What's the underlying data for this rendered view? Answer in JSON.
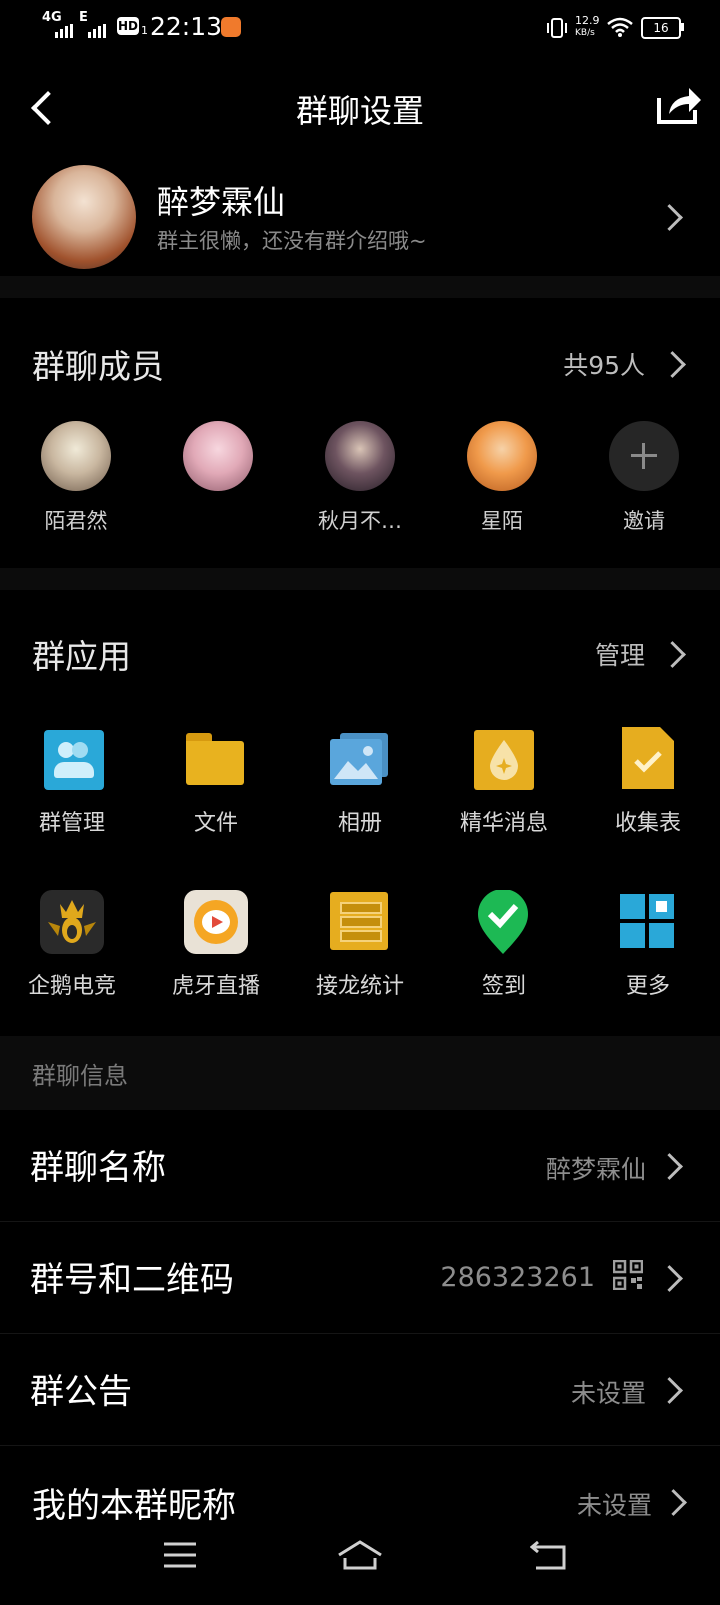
{
  "status_bar": {
    "network1": "4G",
    "network2": "E",
    "hd": "HD",
    "hd_sub": "1",
    "time": "22:13",
    "speed_value": "12.9",
    "speed_unit": "KB/s",
    "battery": "16"
  },
  "header": {
    "title": "群聊设置"
  },
  "group": {
    "name": "醉梦霖仙",
    "description": "群主很懒，还没有群介绍哦~"
  },
  "members": {
    "title": "群聊成员",
    "count": "共95人",
    "list": [
      {
        "name": "陌君然"
      },
      {
        "name": ""
      },
      {
        "name": "秋月不…"
      },
      {
        "name": "星陌"
      },
      {
        "name": "邀请"
      }
    ]
  },
  "apps": {
    "title": "群应用",
    "manage": "管理",
    "items": [
      {
        "label": "群管理",
        "icon": "group-manage-icon"
      },
      {
        "label": "文件",
        "icon": "folder-icon"
      },
      {
        "label": "相册",
        "icon": "album-icon"
      },
      {
        "label": "精华消息",
        "icon": "essence-icon"
      },
      {
        "label": "收集表",
        "icon": "collect-form-icon"
      },
      {
        "label": "企鹅电竞",
        "icon": "penguin-esports-icon"
      },
      {
        "label": "虎牙直播",
        "icon": "huya-live-icon"
      },
      {
        "label": "接龙统计",
        "icon": "solitaire-icon"
      },
      {
        "label": "签到",
        "icon": "checkin-icon"
      },
      {
        "label": "更多",
        "icon": "more-grid-icon"
      }
    ]
  },
  "info": {
    "section_title": "群聊信息",
    "rows": [
      {
        "title": "群聊名称",
        "value": "醉梦霖仙"
      },
      {
        "title": "群号和二维码",
        "value": "286323261"
      },
      {
        "title": "群公告",
        "value": "未设置"
      },
      {
        "title": "我的本群昵称",
        "value": "未设置"
      }
    ]
  },
  "colors": {
    "background": "#000000",
    "section_gap": "#0c0c0c",
    "app_blue": "#2aa8d8",
    "app_gold": "#e6ad1f",
    "app_green": "#1db954"
  }
}
